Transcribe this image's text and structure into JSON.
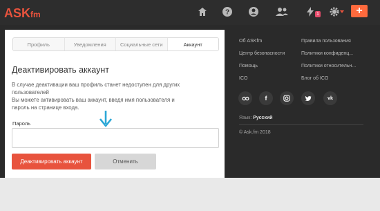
{
  "brand": {
    "logo_main": "ASK",
    "logo_sub": "fm"
  },
  "topbar": {
    "icons": [
      "home-icon",
      "help-icon",
      "profile-icon",
      "friends-icon",
      "activity-icon",
      "settings-icon"
    ],
    "notification_count": "1",
    "add_button": "+"
  },
  "settings": {
    "tabs": [
      {
        "label": "Профиль"
      },
      {
        "label": "Уведомления"
      },
      {
        "label": "Социальные сети"
      },
      {
        "label": "Аккаунт"
      }
    ],
    "active_tab": "Аккаунт"
  },
  "deactivate": {
    "title": "Деактивировать аккаунт",
    "desc_line1": "В случае деактивации ваш профиль станет недоступен для других\nпользователей",
    "desc_line2": "Вы можете активировать ваш аккаунт, введя имя пользователя и\nпароль на странице входа.",
    "password_label": "Пароль",
    "password_value": "",
    "deactivate_button": "Деактивировать аккаунт",
    "cancel_button": "Отменить"
  },
  "footer": {
    "col1": [
      "Об ASKfm",
      "Центр безопасности",
      "Помощь",
      "ICO"
    ],
    "col2": [
      "Правила пользования",
      "Политики конфиденц...",
      "Политики относительн...",
      "Блог об ICO"
    ],
    "social": [
      "vk-ok-icon",
      "facebook-icon",
      "instagram-icon",
      "twitter-icon",
      "vk-icon"
    ],
    "language_label": "Язык:",
    "language_value": "Русский",
    "copyright": "© Ask.fm 2018"
  },
  "colors": {
    "accent": "#e8533d",
    "topbar": "#2d2d2d",
    "background": "#2a2a2a",
    "badge": "#e64a6a",
    "arrow": "#2aa7d6"
  }
}
